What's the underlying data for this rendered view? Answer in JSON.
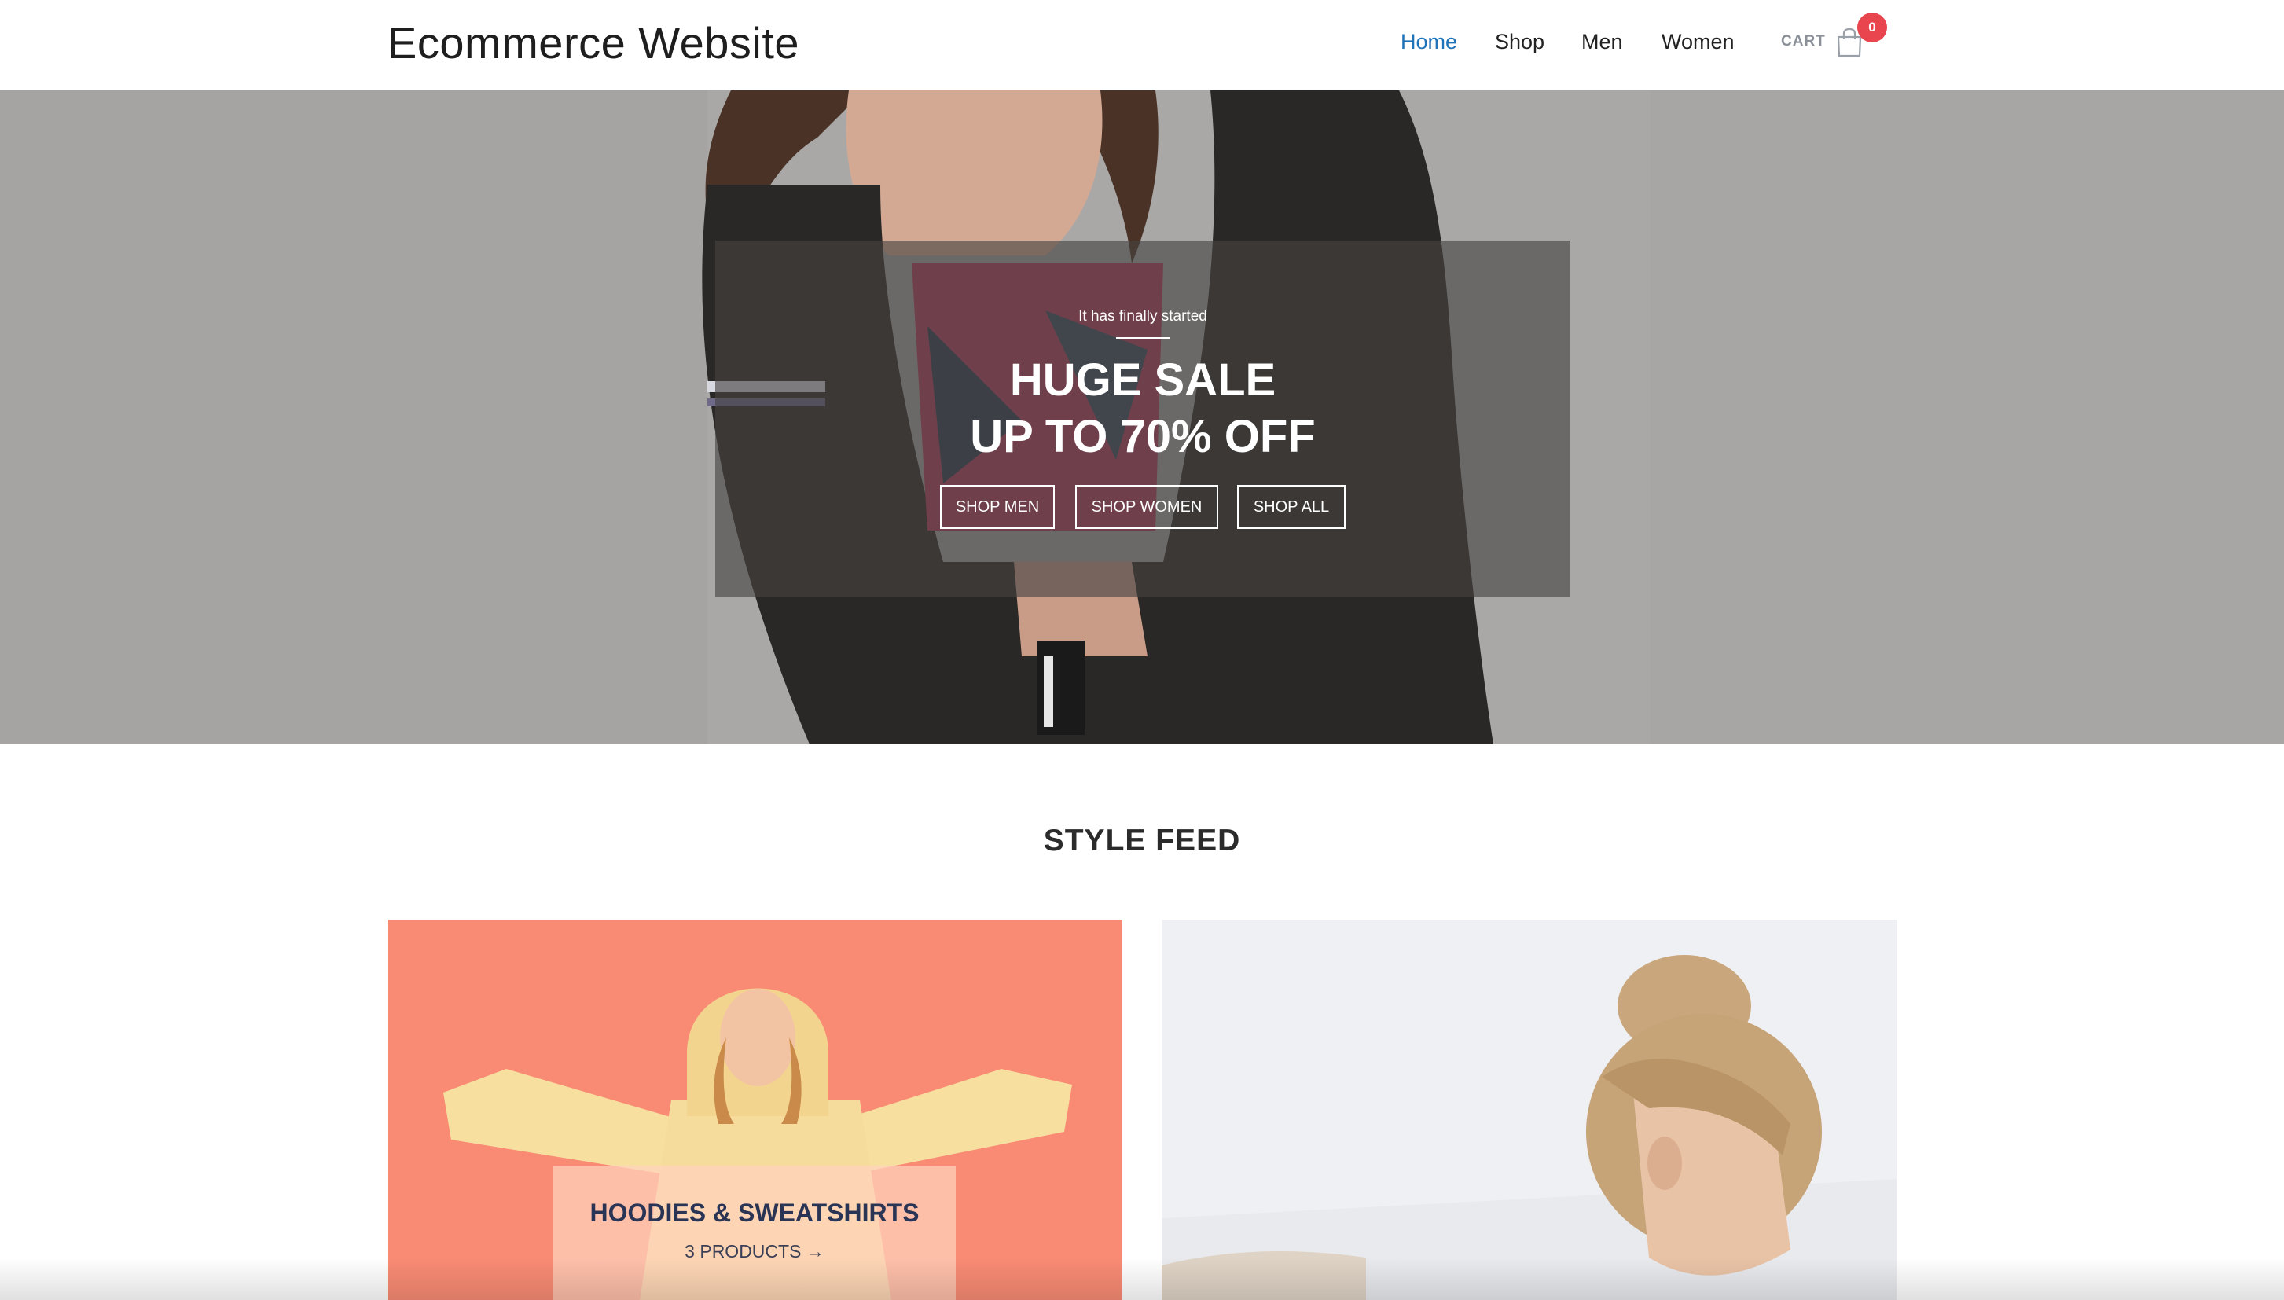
{
  "header": {
    "logo": "Ecommerce Website",
    "nav": [
      {
        "label": "Home",
        "active": true
      },
      {
        "label": "Shop",
        "active": false
      },
      {
        "label": "Men",
        "active": false
      },
      {
        "label": "Women",
        "active": false
      }
    ],
    "cart": {
      "label": "CART",
      "count": "0",
      "icon": "shopping-bag-icon"
    }
  },
  "hero": {
    "kicker": "It has finally started",
    "title_line1": "HUGE SALE",
    "title_line2": "UP TO 70% OFF",
    "buttons": [
      "SHOP MEN",
      "SHOP WOMEN",
      "SHOP ALL"
    ]
  },
  "style_feed": {
    "title": "STYLE FEED",
    "cards": [
      {
        "title": "HOODIES & SWEATSHIRTS",
        "count": "3 PRODUCTS",
        "icon": "arrow-right-icon"
      }
    ]
  },
  "colors": {
    "accent": "#1f73b7",
    "badge": "#e8454f",
    "card_left_bg": "#f98b74",
    "card_right_bg": "#eef0f3"
  }
}
